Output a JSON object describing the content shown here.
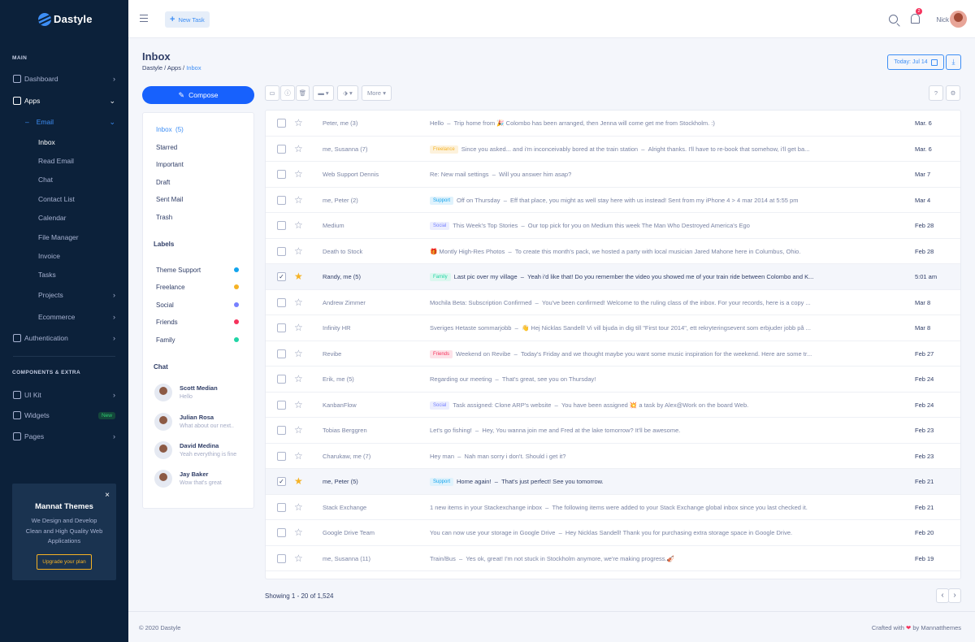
{
  "brand": {
    "name": "Dastyle"
  },
  "sidebar": {
    "main_title": "Main",
    "dashboard": "Dashboard",
    "apps": "Apps",
    "email": "Email",
    "inbox": "Inbox",
    "read_email": "Read Email",
    "chat": "Chat",
    "contact_list": "Contact List",
    "calendar": "Calendar",
    "file_manager": "File Manager",
    "invoice": "Invoice",
    "tasks": "Tasks",
    "projects": "Projects",
    "ecommerce": "Ecommerce",
    "authentication": "Authentication",
    "components_title": "Components & Extra",
    "ui_kit": "UI Kit",
    "widgets": "Widgets",
    "widgets_badge": "New",
    "pages": "Pages"
  },
  "promo": {
    "title": "Mannat Themes",
    "text": "We Design and Develop Clean and High Quality Web Applications",
    "button": "Upgrade your plan",
    "close": "×"
  },
  "topbar": {
    "new_task": "New Task",
    "notif_count": "2",
    "user": "Nick"
  },
  "page": {
    "title": "Inbox",
    "crumb1": "Dastyle",
    "crumb2": "Apps",
    "crumb3": "Inbox",
    "today": "Today: Jul 14"
  },
  "compose": "Compose",
  "folders": [
    {
      "label": "Inbox",
      "count": "(5)"
    },
    {
      "label": "Starred"
    },
    {
      "label": "Important"
    },
    {
      "label": "Draft"
    },
    {
      "label": "Sent Mail"
    },
    {
      "label": "Trash"
    }
  ],
  "labels_title": "Labels",
  "labels": [
    {
      "label": "Theme Support",
      "color": "#12a4ed"
    },
    {
      "label": "Freelance",
      "color": "#f5b225"
    },
    {
      "label": "Social",
      "color": "#7680ff"
    },
    {
      "label": "Friends",
      "color": "#f5325c"
    },
    {
      "label": "Family",
      "color": "#20d4a5"
    }
  ],
  "chat_title": "Chat",
  "chats": [
    {
      "name": "Scott Median",
      "msg": "Hello"
    },
    {
      "name": "Julian Rosa",
      "msg": "What about our next.."
    },
    {
      "name": "David Medina",
      "msg": "Yeah everything is fine"
    },
    {
      "name": "Jay Baker",
      "msg": "Wow that's great"
    }
  ],
  "toolbar": {
    "more": "More"
  },
  "emails": [
    {
      "from": "Peter, me (3)",
      "tag": "",
      "subject": "Hello",
      "preview": "Trip home from 🎉 Colombo has been arranged, then Jenna will come get me from Stockholm. :)",
      "date": "Mar. 6",
      "checked": false,
      "starred": false,
      "read": false
    },
    {
      "from": "me, Susanna (7)",
      "tag": "Freelance",
      "subject": "Since you asked... and i'm inconceivably bored at the train station",
      "preview": "Alright thanks. I'll have to re-book that somehow, i'll get ba...",
      "date": "Mar. 6",
      "checked": false,
      "starred": false,
      "read": false
    },
    {
      "from": "Web Support Dennis",
      "tag": "",
      "subject": "Re: New mail settings",
      "preview": "Will you answer him asap?",
      "date": "Mar 7",
      "checked": false,
      "starred": false,
      "read": false
    },
    {
      "from": "me, Peter (2)",
      "tag": "Support",
      "subject": "Off on Thursday",
      "preview": "Eff that place, you might as well stay here with us instead! Sent from my iPhone 4 > 4 mar 2014 at 5:55 pm",
      "date": "Mar 4",
      "checked": false,
      "starred": false,
      "read": false
    },
    {
      "from": "Medium",
      "tag": "Social",
      "subject": "This Week's Top Stories",
      "preview": "Our top pick for you on Medium this week The Man Who Destroyed America's Ego",
      "date": "Feb 28",
      "checked": false,
      "starred": false,
      "read": false
    },
    {
      "from": "Death to Stock",
      "tag": "",
      "subject": "🎁 Montly High-Res Photos",
      "preview": "To create this month's pack, we hosted a party with local musician Jared Mahone here in Columbus, Ohio.",
      "date": "Feb 28",
      "checked": false,
      "starred": false,
      "read": false
    },
    {
      "from": "Randy, me (5)",
      "tag": "Family",
      "subject": "Last pic over my village",
      "preview": "Yeah i'd like that! Do you remember the video you showed me of your train ride between Colombo and K...",
      "date": "5:01 am",
      "checked": true,
      "starred": true,
      "read": true
    },
    {
      "from": "Andrew Zimmer",
      "tag": "",
      "subject": "Mochila Beta: Subscription Confirmed",
      "preview": "You've been confirmed! Welcome to the ruling class of the inbox. For your records, here is a copy ...",
      "date": "Mar 8",
      "checked": false,
      "starred": false,
      "read": false
    },
    {
      "from": "Infinity HR",
      "tag": "",
      "subject": "Sveriges Hetaste sommarjobb",
      "preview": "👋 Hej Nicklas Sandell! Vi vill bjuda in dig till \"First tour 2014\", ett rekryteringsevent som erbjuder jobb på ...",
      "date": "Mar 8",
      "checked": false,
      "starred": false,
      "read": false
    },
    {
      "from": "Revibe",
      "tag": "Friends",
      "subject": "Weekend on Revibe",
      "preview": "Today's Friday and we thought maybe you want some music inspiration for the weekend. Here are some tr...",
      "date": "Feb 27",
      "checked": false,
      "starred": false,
      "read": false
    },
    {
      "from": "Erik, me (5)",
      "tag": "",
      "subject": "Regarding our meeting",
      "preview": "That's great, see you on Thursday!",
      "date": "Feb 24",
      "checked": false,
      "starred": false,
      "read": false
    },
    {
      "from": "KanbanFlow",
      "tag": "Social",
      "subject": "Task assigned: Clone ARP's website",
      "preview": "You have been assigned 💥 a task by Alex@Work on the board Web.",
      "date": "Feb 24",
      "checked": false,
      "starred": false,
      "read": false
    },
    {
      "from": "Tobias Berggren",
      "tag": "",
      "subject": "Let's go fishing!",
      "preview": "Hey, You wanna join me and Fred at the lake tomorrow? It'll be awesome.",
      "date": "Feb 23",
      "checked": false,
      "starred": false,
      "read": false
    },
    {
      "from": "Charukaw, me (7)",
      "tag": "",
      "subject": "Hey man",
      "preview": "Nah man sorry i don't. Should i get it?",
      "date": "Feb 23",
      "checked": false,
      "starred": false,
      "read": false
    },
    {
      "from": "me, Peter (5)",
      "tag": "Support",
      "subject": "Home again!",
      "preview": "That's just perfect! See you tomorrow.",
      "date": "Feb 21",
      "checked": true,
      "starred": true,
      "read": true
    },
    {
      "from": "Stack Exchange",
      "tag": "",
      "subject": "1 new items in your Stackexchange inbox",
      "preview": "The following items were added to your Stack Exchange global inbox since you last checked it.",
      "date": "Feb 21",
      "checked": false,
      "starred": false,
      "read": false
    },
    {
      "from": "Google Drive Team",
      "tag": "",
      "subject": "You can now use your storage in Google Drive",
      "preview": "Hey Nicklas Sandell! Thank you for purchasing extra storage space in Google Drive.",
      "date": "Feb 20",
      "checked": false,
      "starred": false,
      "read": false
    },
    {
      "from": "me, Susanna (11)",
      "tag": "",
      "subject": "Train/Bus",
      "preview": "Yes ok, great! I'm not stuck in Stockholm anymore, we're making progress.🎻",
      "date": "Feb 19",
      "checked": false,
      "starred": false,
      "read": false
    }
  ],
  "tag_colors": {
    "Freelance": {
      "bg": "#fdf2dc",
      "fg": "#f5b225"
    },
    "Support": {
      "bg": "#dff2fc",
      "fg": "#12a4ed"
    },
    "Social": {
      "bg": "#eceefe",
      "fg": "#7680ff"
    },
    "Family": {
      "bg": "#dcf7ef",
      "fg": "#20d4a5"
    },
    "Friends": {
      "bg": "#fde2e8",
      "fg": "#f5325c"
    }
  },
  "pagination": {
    "showing": "Showing 1 - 20 of 1,524",
    "prev": "‹",
    "next": "›"
  },
  "footer": {
    "copyright": "© 2020 Dastyle",
    "crafted": "Crafted with",
    "heart": "❤",
    "by": "by Mannatthemes"
  }
}
